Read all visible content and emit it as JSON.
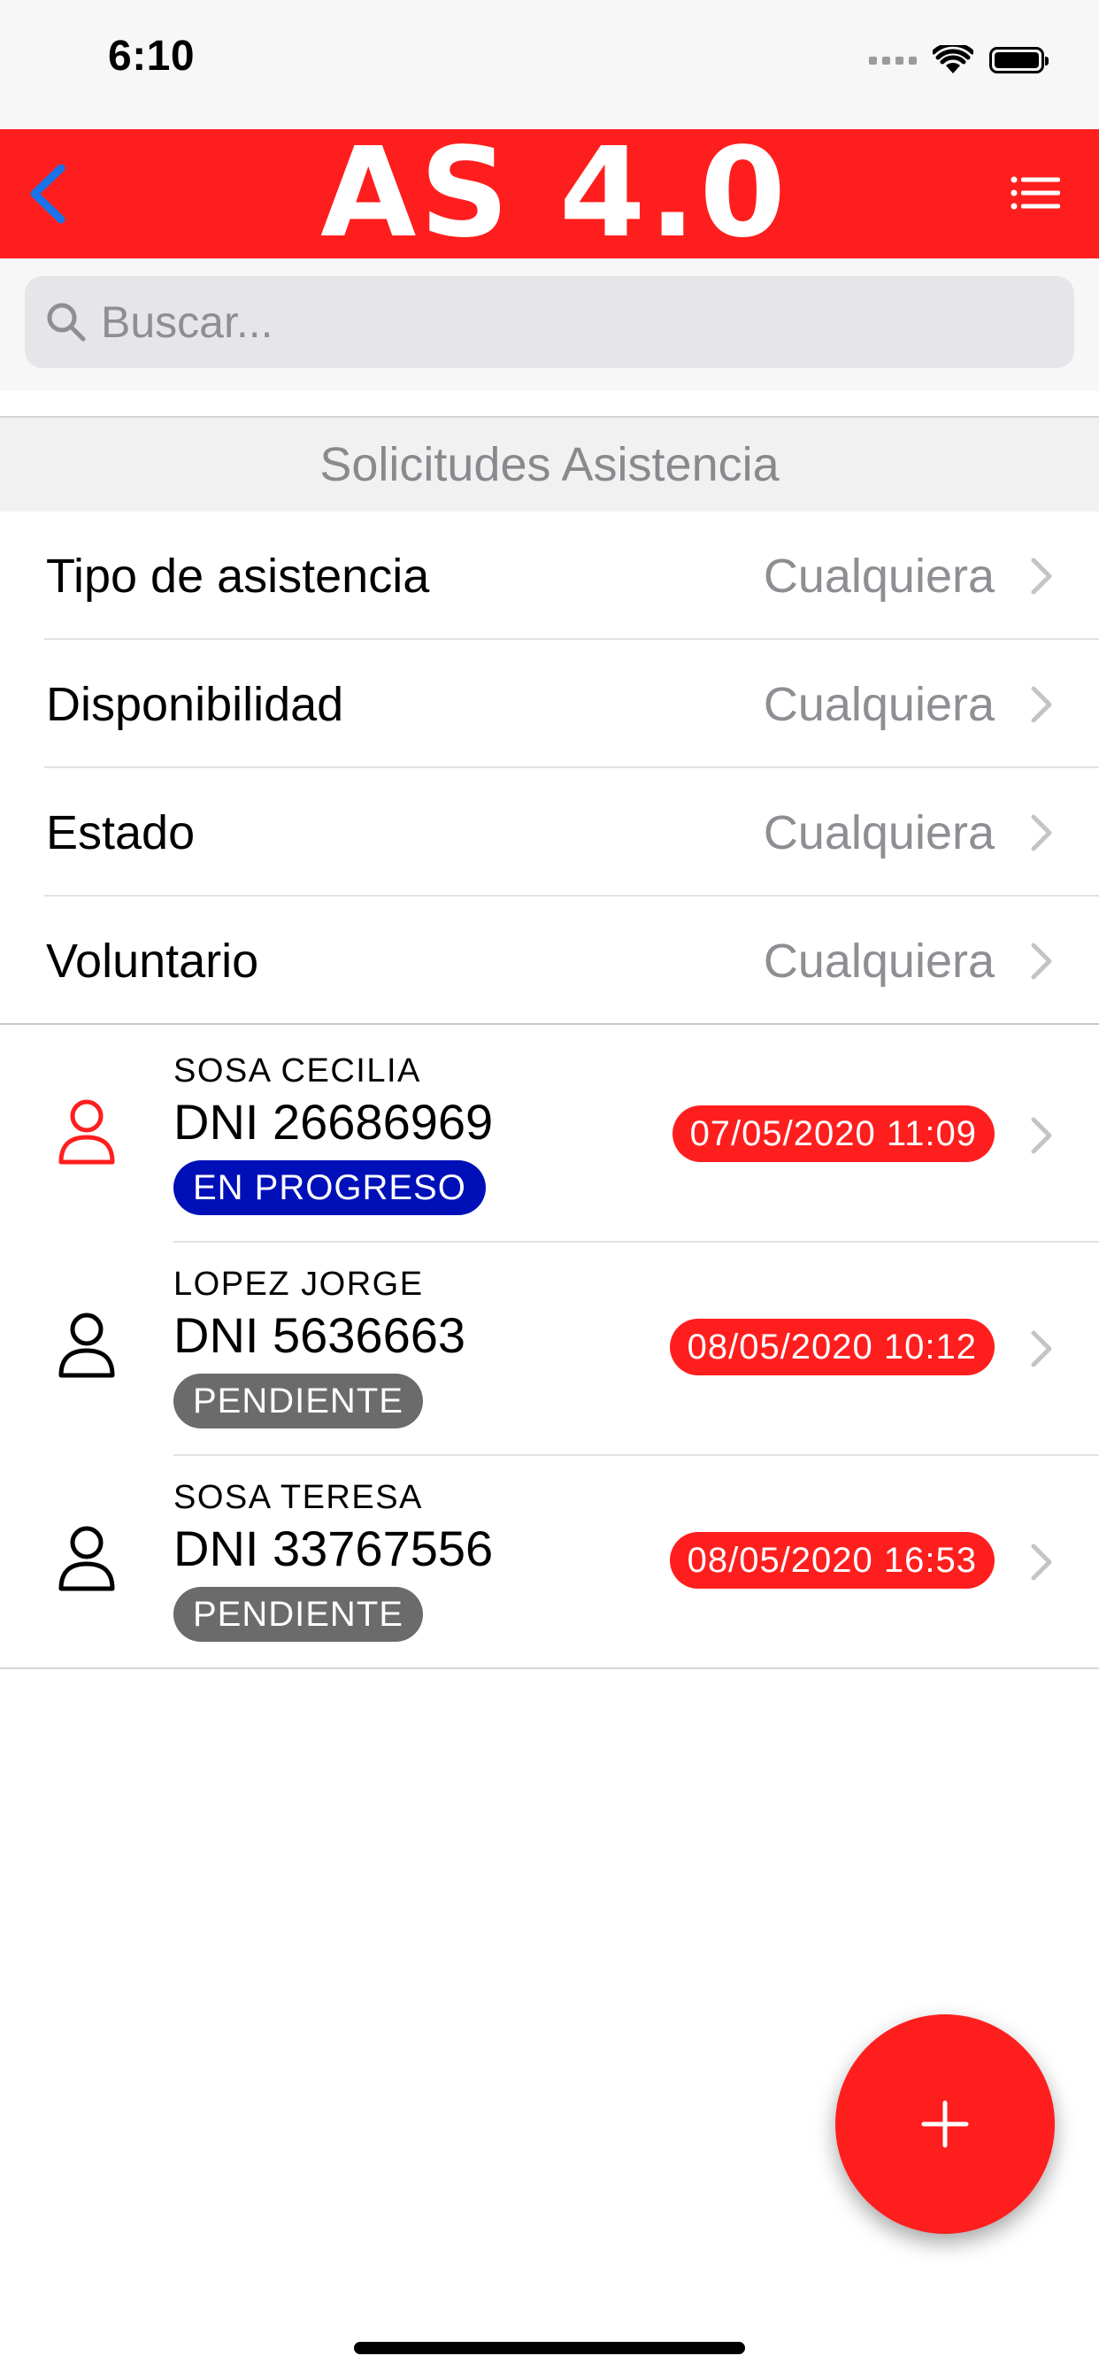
{
  "status_bar": {
    "time": "6:10"
  },
  "nav": {
    "title": "AS 4.0"
  },
  "search": {
    "placeholder": "Buscar..."
  },
  "section": {
    "title": "Solicitudes Asistencia"
  },
  "filters": [
    {
      "label": "Tipo de asistencia",
      "value": "Cualquiera"
    },
    {
      "label": "Disponibilidad",
      "value": "Cualquiera"
    },
    {
      "label": "Estado",
      "value": "Cualquiera"
    },
    {
      "label": "Voluntario",
      "value": "Cualquiera"
    }
  ],
  "requests": [
    {
      "name": "SOSA CECILIA",
      "dni": "DNI 26686969",
      "status": "EN PROGRESO",
      "date": "07/05/2020 11:09",
      "avatar_color": "#ff1e1e"
    },
    {
      "name": "LOPEZ JORGE",
      "dni": "DNI 5636663",
      "status": "PENDIENTE",
      "date": "08/05/2020 10:12",
      "avatar_color": "#000000"
    },
    {
      "name": "SOSA TERESA",
      "dni": "DNI 33767556",
      "status": "PENDIENTE",
      "date": "08/05/2020 16:53",
      "avatar_color": "#000000"
    }
  ],
  "colors": {
    "brand": "#ff1e1e",
    "in_progress": "#0010b8",
    "pending": "#6b6b6b",
    "back_arrow": "#1a73e8"
  }
}
